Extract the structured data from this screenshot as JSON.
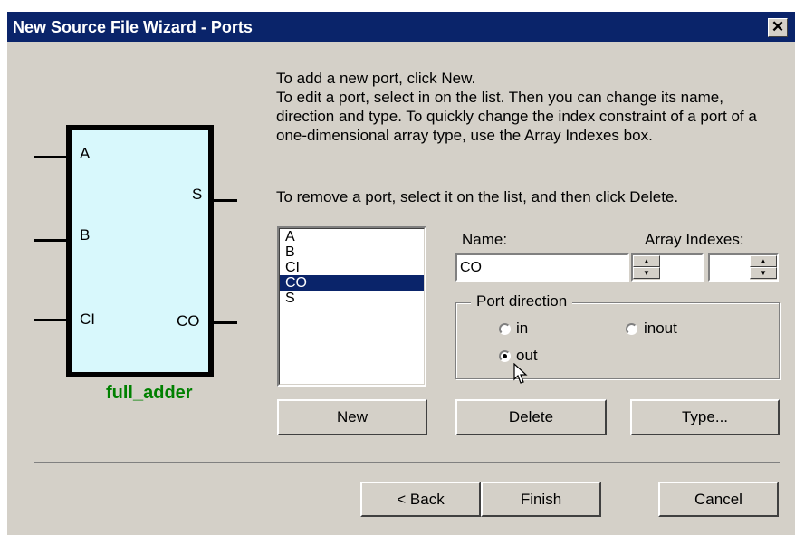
{
  "window": {
    "title": "New Source File Wizard - Ports",
    "close_glyph": "✕"
  },
  "diagram": {
    "name": "full_adder",
    "inputs": [
      "A",
      "B",
      "CI"
    ],
    "outputs": [
      "S",
      "CO"
    ]
  },
  "instructions": {
    "line1": "To add a new port, click New.",
    "line2": "To edit a port, select in on the list. Then you can change its name, direction and type. To quickly change the index constraint of a port of a one-dimensional array type, use the Array Indexes box.",
    "line3": "To remove a port, select it on the list, and then click Delete."
  },
  "ports": {
    "items": [
      "A",
      "B",
      "CI",
      "CO",
      "S"
    ],
    "selected": "CO"
  },
  "fields": {
    "name_label": "Name:",
    "name_value": "CO",
    "array_indexes_label": "Array Indexes:"
  },
  "port_direction": {
    "label": "Port direction",
    "in_label": "in",
    "inout_label": "inout",
    "out_label": "out",
    "selected": "out"
  },
  "buttons": {
    "new": "New",
    "delete": "Delete",
    "type": "Type...",
    "back": "< Back",
    "finish": "Finish",
    "cancel": "Cancel"
  },
  "colors": {
    "title_bar": "#0a246a",
    "block_fill": "#d8f8fc",
    "block_name": "#008000",
    "selection": "#0a246a"
  }
}
